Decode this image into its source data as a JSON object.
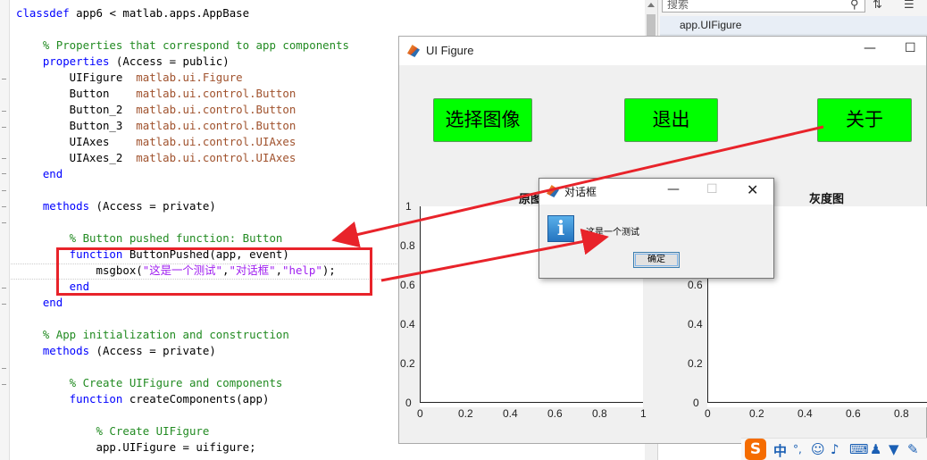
{
  "editor": {
    "lines": [
      {
        "i": 0,
        "parts": [
          {
            "t": "classdef",
            "c": "kw"
          },
          {
            "t": " app6 < matlab.apps.AppBase",
            "c": ""
          }
        ]
      },
      {
        "i": 2,
        "parts": [
          {
            "t": "    % Properties that correspond to app components",
            "c": "cm"
          }
        ]
      },
      {
        "i": 3,
        "parts": [
          {
            "t": "    properties",
            "c": "kw"
          },
          {
            "t": " (Access = public)",
            "c": ""
          }
        ]
      },
      {
        "i": 4,
        "parts": [
          {
            "t": "        UIFigure  ",
            "c": ""
          },
          {
            "t": "matlab.ui.Figure",
            "c": "ty"
          }
        ]
      },
      {
        "i": 5,
        "parts": [
          {
            "t": "        Button    ",
            "c": ""
          },
          {
            "t": "matlab.ui.control.Button",
            "c": "ty"
          }
        ]
      },
      {
        "i": 6,
        "parts": [
          {
            "t": "        Button_2  ",
            "c": ""
          },
          {
            "t": "matlab.ui.control.Button",
            "c": "ty"
          }
        ]
      },
      {
        "i": 7,
        "parts": [
          {
            "t": "        Button_3  ",
            "c": ""
          },
          {
            "t": "matlab.ui.control.Button",
            "c": "ty"
          }
        ]
      },
      {
        "i": 8,
        "parts": [
          {
            "t": "        UIAxes    ",
            "c": ""
          },
          {
            "t": "matlab.ui.control.UIAxes",
            "c": "ty"
          }
        ]
      },
      {
        "i": 9,
        "parts": [
          {
            "t": "        UIAxes_2  ",
            "c": ""
          },
          {
            "t": "matlab.ui.control.UIAxes",
            "c": "ty"
          }
        ]
      },
      {
        "i": 10,
        "parts": [
          {
            "t": "    end",
            "c": "kw"
          }
        ]
      },
      {
        "i": 12,
        "parts": [
          {
            "t": "    methods",
            "c": "kw"
          },
          {
            "t": " (Access = private)",
            "c": ""
          }
        ]
      },
      {
        "i": 14,
        "parts": [
          {
            "t": "        % Button pushed function: Button",
            "c": "cm"
          }
        ]
      },
      {
        "i": 15,
        "parts": [
          {
            "t": "        function",
            "c": "kw"
          },
          {
            "t": " ButtonPushed(app, event)",
            "c": ""
          }
        ]
      },
      {
        "i": 16,
        "parts": [
          {
            "t": "            msgbox(",
            "c": ""
          },
          {
            "t": "\"这是一个测试\"",
            "c": "st"
          },
          {
            "t": ",",
            "c": ""
          },
          {
            "t": "\"对话框\"",
            "c": "st"
          },
          {
            "t": ",",
            "c": ""
          },
          {
            "t": "\"help\"",
            "c": "st"
          },
          {
            "t": ");",
            "c": ""
          }
        ]
      },
      {
        "i": 17,
        "parts": [
          {
            "t": "        end",
            "c": "kw"
          }
        ]
      },
      {
        "i": 18,
        "parts": [
          {
            "t": "    end",
            "c": "kw"
          }
        ]
      },
      {
        "i": 20,
        "parts": [
          {
            "t": "    % App initialization and construction",
            "c": "cm"
          }
        ]
      },
      {
        "i": 21,
        "parts": [
          {
            "t": "    methods",
            "c": "kw"
          },
          {
            "t": " (Access = private)",
            "c": ""
          }
        ]
      },
      {
        "i": 23,
        "parts": [
          {
            "t": "        % Create UIFigure and components",
            "c": "cm"
          }
        ]
      },
      {
        "i": 24,
        "parts": [
          {
            "t": "        function",
            "c": "kw"
          },
          {
            "t": " createComponents(app)",
            "c": ""
          }
        ]
      },
      {
        "i": 26,
        "parts": [
          {
            "t": "            % Create UIFigure",
            "c": "cm"
          }
        ]
      },
      {
        "i": 27,
        "parts": [
          {
            "t": "            app.UIFigure = uifigure;",
            "c": ""
          }
        ]
      }
    ]
  },
  "right_panel": {
    "search_placeholder": "搜索",
    "item": "app.UIFigure"
  },
  "figure": {
    "title": "UI Figure",
    "buttons": [
      "选择图像",
      "退出",
      "关于"
    ],
    "axes1": {
      "title": "原图",
      "yticks": [
        "0",
        "0.2",
        "0.4",
        "0.6",
        "0.8",
        "1"
      ],
      "xticks": [
        "0",
        "0.2",
        "0.4",
        "0.6",
        "0.8",
        "1"
      ]
    },
    "axes2": {
      "title": "灰度图",
      "yticks": [
        "0",
        "0.2",
        "0.4",
        "0.6"
      ],
      "xticks": [
        "0",
        "0.2",
        "0.4",
        "0.6",
        "0.8"
      ]
    }
  },
  "dialog": {
    "title": "对话框",
    "message": "这是一个测试",
    "ok": "确定",
    "icon": "info-icon"
  },
  "ime": {
    "chinese": "中",
    "punct": "°,"
  },
  "annotation_color": "#e8232a",
  "button_color": "#00ff00"
}
